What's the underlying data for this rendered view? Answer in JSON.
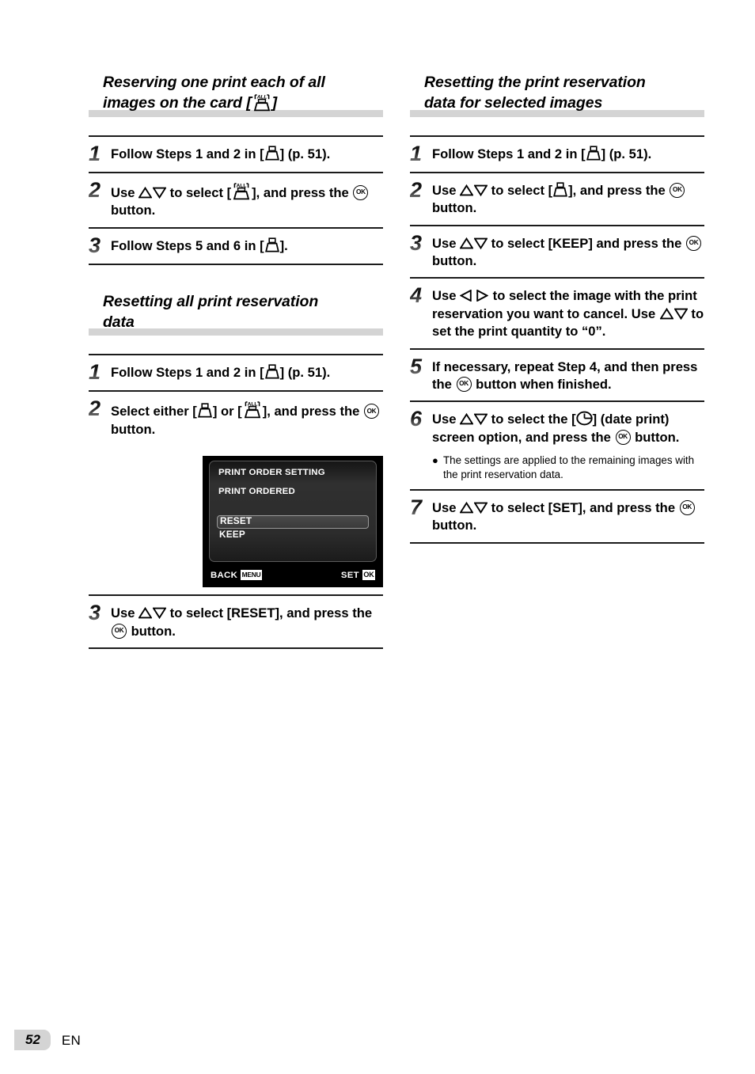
{
  "page": {
    "number": "52",
    "language": "EN"
  },
  "left_column": {
    "sections": [
      {
        "id": "reserve-all",
        "heading_line1": "Reserving one print each of all",
        "heading_line2_prefix": "images on the card [",
        "heading_icon": "printer-all-icon",
        "heading_line2_suffix": "]",
        "steps": [
          {
            "num": "1",
            "parts": [
              {
                "t": "text",
                "v": "Follow Steps 1 and 2 in ["
              },
              {
                "t": "icon",
                "v": "printer-icon"
              },
              {
                "t": "text",
                "v": "] (p. 51)."
              }
            ]
          },
          {
            "num": "2",
            "parts": [
              {
                "t": "text",
                "v": "Use "
              },
              {
                "t": "icon",
                "v": "triangle-up-icon"
              },
              {
                "t": "icon",
                "v": "triangle-down-icon"
              },
              {
                "t": "text",
                "v": " to select ["
              },
              {
                "t": "icon",
                "v": "printer-all-icon"
              },
              {
                "t": "text",
                "v": "], and press the "
              },
              {
                "t": "icon",
                "v": "ok-button-icon"
              },
              {
                "t": "text",
                "v": " button."
              }
            ]
          },
          {
            "num": "3",
            "parts": [
              {
                "t": "text",
                "v": "Follow Steps 5 and 6 in ["
              },
              {
                "t": "icon",
                "v": "printer-icon"
              },
              {
                "t": "text",
                "v": "]."
              }
            ]
          }
        ]
      },
      {
        "id": "reset-all",
        "heading_line1": "Resetting all print reservation",
        "heading_line2_prefix": "data",
        "heading_icon": null,
        "heading_line2_suffix": "",
        "steps": [
          {
            "num": "1",
            "parts": [
              {
                "t": "text",
                "v": "Follow Steps 1 and 2 in ["
              },
              {
                "t": "icon",
                "v": "printer-icon"
              },
              {
                "t": "text",
                "v": "] (p. 51)."
              }
            ]
          },
          {
            "num": "2",
            "parts": [
              {
                "t": "text",
                "v": "Select either ["
              },
              {
                "t": "icon",
                "v": "printer-icon"
              },
              {
                "t": "text",
                "v": "] or ["
              },
              {
                "t": "icon",
                "v": "printer-all-icon"
              },
              {
                "t": "text",
                "v": "], and press the "
              },
              {
                "t": "icon",
                "v": "ok-button-icon"
              },
              {
                "t": "text",
                "v": " button."
              }
            ],
            "has_lcd": true
          },
          {
            "num": "3",
            "parts": [
              {
                "t": "text",
                "v": "Use "
              },
              {
                "t": "icon",
                "v": "triangle-up-icon"
              },
              {
                "t": "icon",
                "v": "triangle-down-icon"
              },
              {
                "t": "text",
                "v": " to select [RESET], and press the "
              },
              {
                "t": "icon",
                "v": "ok-button-icon"
              },
              {
                "t": "text",
                "v": " button."
              }
            ]
          }
        ]
      }
    ]
  },
  "lcd_screen": {
    "title": "PRINT ORDER SETTING",
    "subtitle": "PRINT ORDERED",
    "options": [
      {
        "label": "RESET",
        "selected": true
      },
      {
        "label": "KEEP",
        "selected": false
      }
    ],
    "footer_left_label": "BACK",
    "footer_left_badge": "MENU",
    "footer_right_label": "SET",
    "footer_right_badge": "OK"
  },
  "right_column": {
    "sections": [
      {
        "id": "reset-selected",
        "heading_line1": "Resetting the print reservation",
        "heading_line2_prefix": "data for selected images",
        "heading_icon": null,
        "heading_line2_suffix": "",
        "steps": [
          {
            "num": "1",
            "parts": [
              {
                "t": "text",
                "v": "Follow Steps 1 and 2 in ["
              },
              {
                "t": "icon",
                "v": "printer-icon"
              },
              {
                "t": "text",
                "v": "] (p. 51)."
              }
            ]
          },
          {
            "num": "2",
            "parts": [
              {
                "t": "text",
                "v": "Use "
              },
              {
                "t": "icon",
                "v": "triangle-up-icon"
              },
              {
                "t": "icon",
                "v": "triangle-down-icon"
              },
              {
                "t": "text",
                "v": " to select ["
              },
              {
                "t": "icon",
                "v": "printer-icon"
              },
              {
                "t": "text",
                "v": "], and press the "
              },
              {
                "t": "icon",
                "v": "ok-button-icon"
              },
              {
                "t": "text",
                "v": " button."
              }
            ]
          },
          {
            "num": "3",
            "parts": [
              {
                "t": "text",
                "v": "Use "
              },
              {
                "t": "icon",
                "v": "triangle-up-icon"
              },
              {
                "t": "icon",
                "v": "triangle-down-icon"
              },
              {
                "t": "text",
                "v": " to select [KEEP] and press the "
              },
              {
                "t": "icon",
                "v": "ok-button-icon"
              },
              {
                "t": "text",
                "v": " button."
              }
            ]
          },
          {
            "num": "4",
            "parts": [
              {
                "t": "text",
                "v": "Use "
              },
              {
                "t": "icon",
                "v": "triangle-left-icon"
              },
              {
                "t": "icon",
                "v": "triangle-right-icon"
              },
              {
                "t": "text",
                "v": " to select the image with the print reservation you want to cancel. Use "
              },
              {
                "t": "icon",
                "v": "triangle-up-icon"
              },
              {
                "t": "icon",
                "v": "triangle-down-icon"
              },
              {
                "t": "text",
                "v": " to set the print quantity to “0”."
              }
            ]
          },
          {
            "num": "5",
            "parts": [
              {
                "t": "text",
                "v": "If necessary, repeat Step 4, and then press the "
              },
              {
                "t": "icon",
                "v": "ok-button-icon"
              },
              {
                "t": "text",
                "v": " button when finished."
              }
            ]
          },
          {
            "num": "6",
            "parts": [
              {
                "t": "text",
                "v": "Use "
              },
              {
                "t": "icon",
                "v": "triangle-up-icon"
              },
              {
                "t": "icon",
                "v": "triangle-down-icon"
              },
              {
                "t": "text",
                "v": " to select the ["
              },
              {
                "t": "icon",
                "v": "date-print-clock-icon"
              },
              {
                "t": "text",
                "v": "] (date print) screen option, and press the "
              },
              {
                "t": "icon",
                "v": "ok-button-icon"
              },
              {
                "t": "text",
                "v": " button."
              }
            ],
            "note": "The settings are applied to the remaining images with the print reservation data."
          },
          {
            "num": "7",
            "parts": [
              {
                "t": "text",
                "v": "Use "
              },
              {
                "t": "icon",
                "v": "triangle-up-icon"
              },
              {
                "t": "icon",
                "v": "triangle-down-icon"
              },
              {
                "t": "text",
                "v": " to select [SET], and press the "
              },
              {
                "t": "icon",
                "v": "ok-button-icon"
              },
              {
                "t": "text",
                "v": " button."
              }
            ]
          }
        ]
      }
    ]
  }
}
